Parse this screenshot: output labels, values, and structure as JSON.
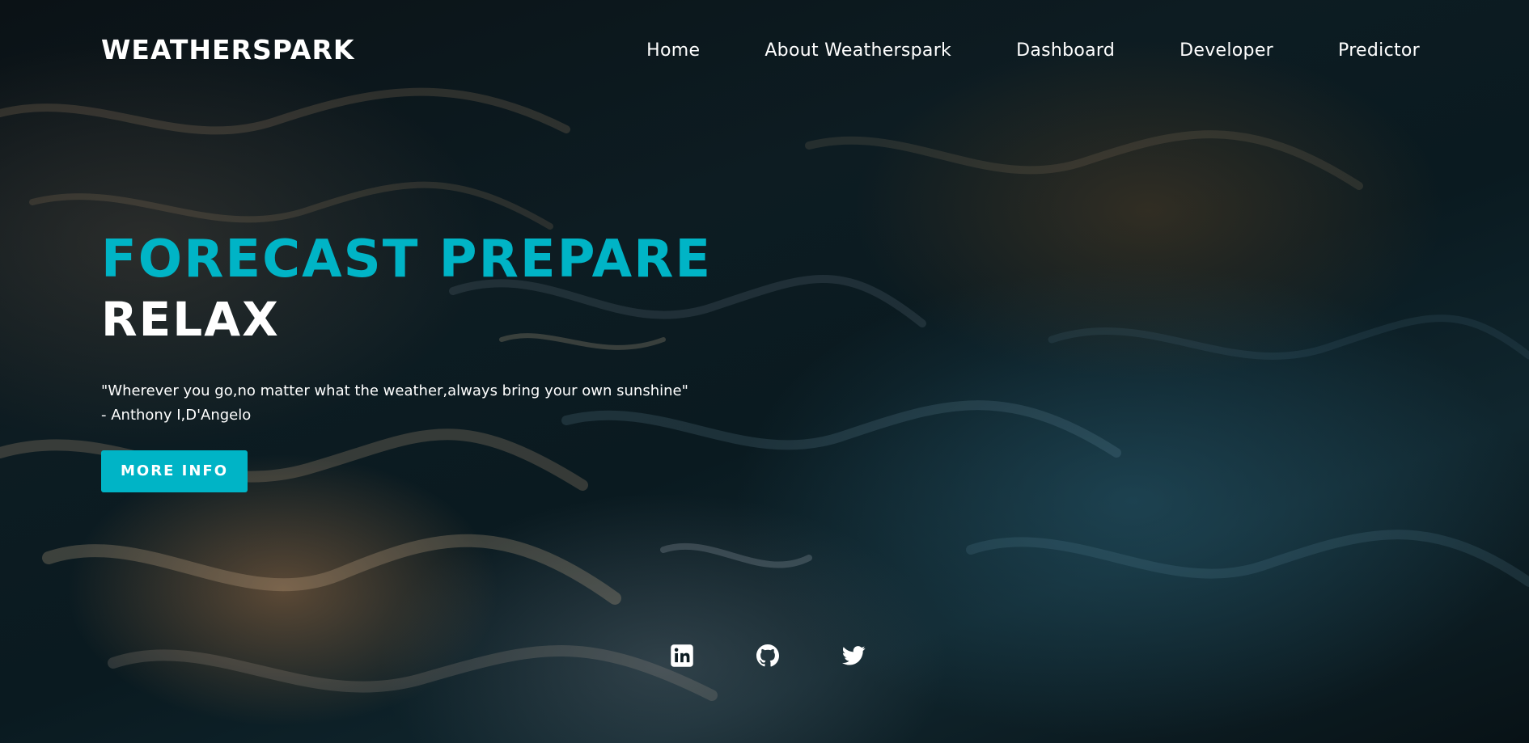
{
  "header": {
    "logo": "WEATHERSPARK",
    "nav": [
      {
        "label": "Home"
      },
      {
        "label": "About Weatherspark"
      },
      {
        "label": "Dashboard"
      },
      {
        "label": "Developer"
      },
      {
        "label": "Predictor"
      }
    ]
  },
  "hero": {
    "headline_accent": "FORECAST PREPARE",
    "headline_white": "RELAX",
    "quote_line1": "\"Wherever you go,no matter what the weather,always bring your own sunshine\"",
    "quote_line2": "- Anthony I,D'Angelo",
    "button_label": "MORE INFO"
  },
  "social": [
    {
      "icon": "linkedin-icon"
    },
    {
      "icon": "github-icon"
    },
    {
      "icon": "twitter-icon"
    }
  ],
  "colors": {
    "accent": "#00b4c6",
    "text": "#ffffff"
  }
}
